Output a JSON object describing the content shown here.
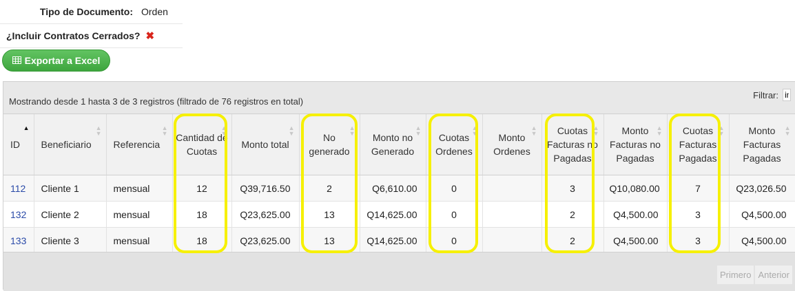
{
  "filters": {
    "tipo_label": "Tipo de Documento:",
    "tipo_value": "Orden",
    "cerrados_label": "¿Incluir Contratos Cerrados?",
    "cerrados_value": "✖"
  },
  "export_button": {
    "label": "Exportar a Excel",
    "icon": "table-icon"
  },
  "table_info": "Mostrando desde 1 hasta 3 de 3 registros (filtrado de 76 registros en total)",
  "search": {
    "label": "Filtrar:",
    "value": "in"
  },
  "columns": [
    "ID",
    "Beneficiario",
    "Referencia",
    "Cantidad de Cuotas",
    "Monto total",
    "No generado",
    "Monto no Generado",
    "Cuotas Ordenes",
    "Monto Ordenes",
    "Cuotas Facturas no Pagadas",
    "Monto Facturas no Pagadas",
    "Cuotas Facturas Pagadas",
    "Monto Facturas Pagadas"
  ],
  "rows": [
    [
      "112",
      "Cliente 1",
      "mensual",
      "12",
      "Q39,716.50",
      "2",
      "Q6,610.00",
      "0",
      "",
      "3",
      "Q10,080.00",
      "7",
      "Q23,026.50"
    ],
    [
      "132",
      "Cliente 2",
      "mensual",
      "18",
      "Q23,625.00",
      "13",
      "Q14,625.00",
      "0",
      "",
      "2",
      "Q4,500.00",
      "3",
      "Q4,500.00"
    ],
    [
      "133",
      "Cliente 3",
      "mensual",
      "18",
      "Q23,625.00",
      "13",
      "Q14,625.00",
      "0",
      "",
      "2",
      "Q4,500.00",
      "3",
      "Q4,500.00"
    ]
  ],
  "pager": {
    "first": "Primero",
    "prev": "Anterior"
  },
  "highlight_color": "#f6f000",
  "accent_green": "#3ea63e",
  "link_color": "#2a4aa8"
}
